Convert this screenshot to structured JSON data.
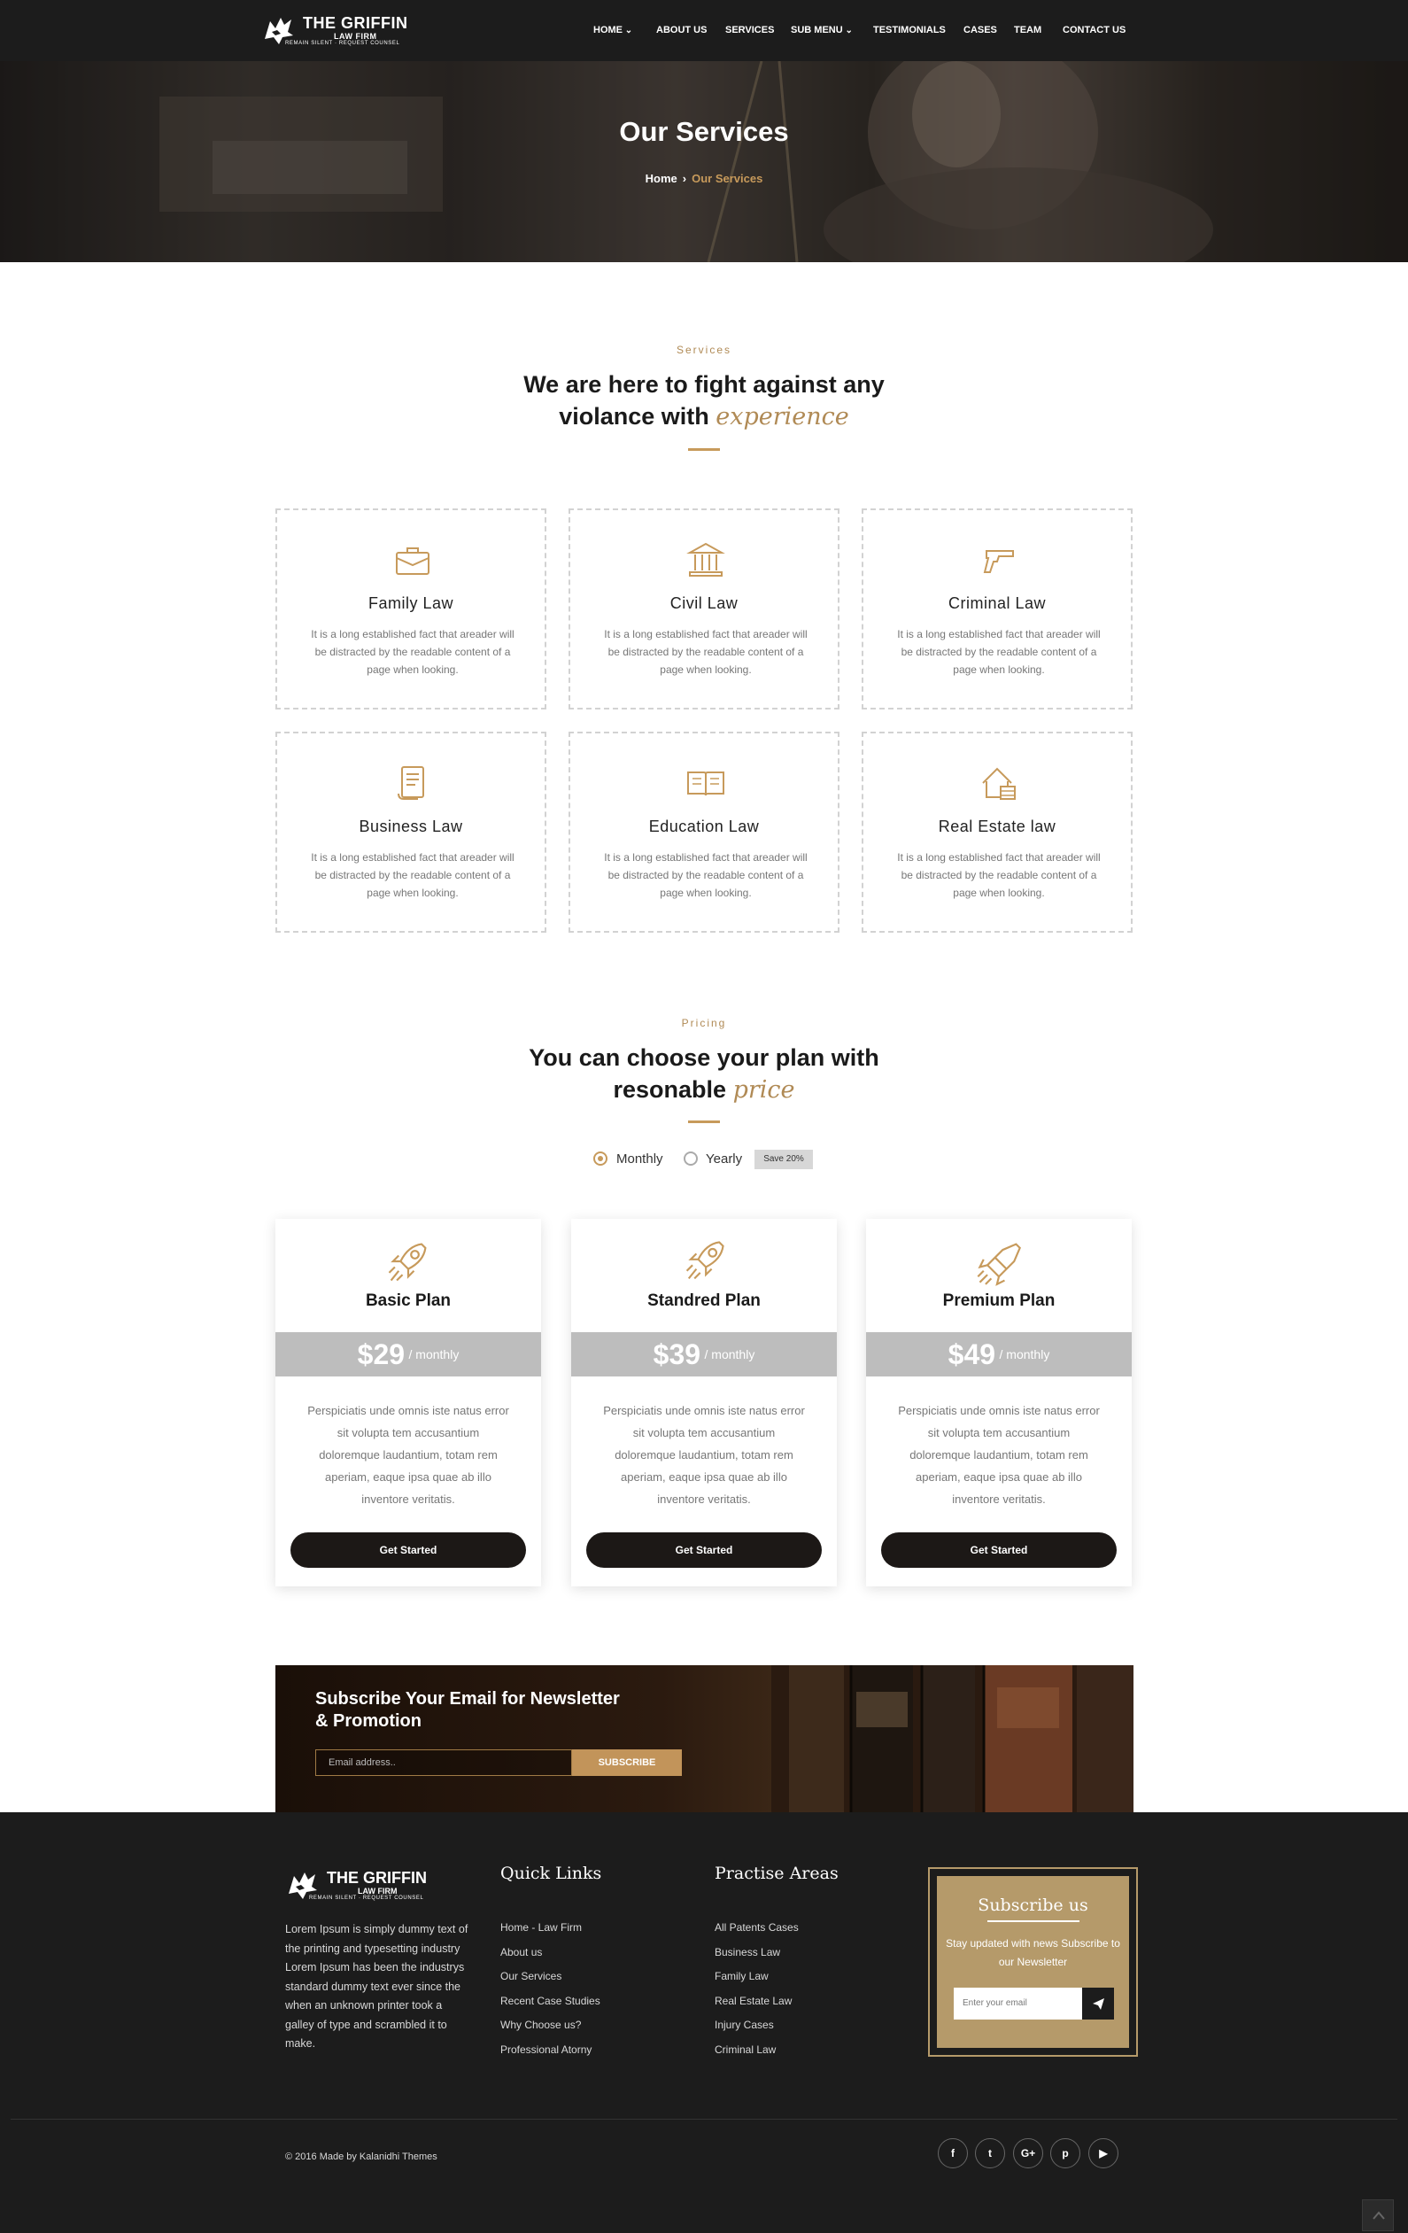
{
  "brand": {
    "name": "THE GRIFFIN",
    "sub": "LAW FIRM",
    "tagline": "REMAIN SILENT · REQUEST COUNSEL"
  },
  "nav": [
    {
      "label": "HOME",
      "dropdown": true
    },
    {
      "label": "ABOUT US",
      "dropdown": false
    },
    {
      "label": "SERVICES",
      "dropdown": false
    },
    {
      "label": "SUB MENU",
      "dropdown": true
    },
    {
      "label": "TESTIMONIALS",
      "dropdown": false
    },
    {
      "label": "CASES",
      "dropdown": false
    },
    {
      "label": "TEAM",
      "dropdown": false
    },
    {
      "label": "CONTACT US",
      "dropdown": false
    }
  ],
  "hero": {
    "title": "Our Services",
    "crumb_home": "Home",
    "crumb_sep": "›",
    "crumb_current": "Our Services"
  },
  "services": {
    "eyebrow": "Services",
    "title_line1": "We are here to fight against any",
    "title_line2": "violance with",
    "title_accent": "experience",
    "items": [
      {
        "icon": "briefcase-icon",
        "title": "Family Law",
        "text": "It is a long established fact that areader will be distracted by the readable content of a page when looking."
      },
      {
        "icon": "courthouse-icon",
        "title": "Civil Law",
        "text": "It is a long established fact that areader will be distracted by the readable content of a page when looking."
      },
      {
        "icon": "handgun-icon",
        "title": "Criminal Law",
        "text": "It is a long established fact that areader will be distracted by the readable content of a page when looking."
      },
      {
        "icon": "scroll-document-icon",
        "title": "Business Law",
        "text": "It is a long established fact that areader will be distracted by the readable content of a page when looking."
      },
      {
        "icon": "open-book-icon",
        "title": "Education Law",
        "text": "It is a long established fact that areader will be distracted by the readable content of a page when looking."
      },
      {
        "icon": "house-icon",
        "title": "Real Estate law",
        "text": "It is a long established fact that areader will be distracted by the readable content of a page when looking."
      }
    ]
  },
  "pricing": {
    "eyebrow": "Pricing",
    "title_line1": "You can choose your plan with",
    "title_line2": "resonable",
    "title_accent": "price",
    "toggle_monthly": "Monthly",
    "toggle_yearly": "Yearly",
    "save_badge": "Save 20%",
    "selected": "Monthly",
    "plans": [
      {
        "icon": "rocket-icon",
        "name": "Basic Plan",
        "price": "$29",
        "period": "/ monthly",
        "text": "Perspiciatis unde omnis iste natus error sit volupta tem accusantium doloremque laudantium, totam rem aperiam, eaque ipsa quae ab illo inventore veritatis.",
        "button": "Get Started"
      },
      {
        "icon": "rocket-launch-icon",
        "name": "Standred Plan",
        "price": "$39",
        "period": "/ monthly",
        "text": "Perspiciatis unde omnis iste natus error sit volupta tem accusantium doloremque laudantium, totam rem aperiam, eaque ipsa quae ab illo inventore veritatis.",
        "button": "Get Started"
      },
      {
        "icon": "space-shuttle-icon",
        "name": "Premium Plan",
        "price": "$49",
        "period": "/ monthly",
        "text": "Perspiciatis unde omnis iste natus error sit volupta tem accusantium doloremque laudantium, totam rem aperiam, eaque ipsa quae ab illo inventore veritatis.",
        "button": "Get Started"
      }
    ]
  },
  "newsletter": {
    "title_line1": "Subscribe Your Email for Newsletter",
    "title_line2": "& Promotion",
    "placeholder": "Email address..",
    "button": "SUBSCRIBE"
  },
  "footer": {
    "about": "Lorem Ipsum is simply dummy text of the printing and typesetting industry Lorem Ipsum has been the industrys standard dummy text ever since the when an unknown printer took a galley of type and scrambled it to make.",
    "quick_links_title": "Quick Links",
    "quick_links": [
      "Home - Law Firm",
      "About us",
      "Our Services",
      "Recent Case Studies",
      "Why Choose us?",
      "Professional Atorny"
    ],
    "practise_title": "Practise Areas",
    "practise_links": [
      "All Patents Cases",
      "Business Law",
      "Family Law",
      "Real Estate Law",
      "Injury Cases",
      "Criminal Law"
    ],
    "subscribe_title": "Subscribe us",
    "subscribe_text": "Stay updated with news Subscribe to our Newsletter",
    "subscribe_placeholder": "Enter your email",
    "copyright": "© 2016 Made by Kalanidhi Themes",
    "social": [
      {
        "icon": "facebook-icon",
        "glyph": "f"
      },
      {
        "icon": "twitter-icon",
        "glyph": "t"
      },
      {
        "icon": "google-plus-icon",
        "glyph": "G+"
      },
      {
        "icon": "pinterest-icon",
        "glyph": "p"
      },
      {
        "icon": "youtube-icon",
        "glyph": "▶"
      }
    ]
  },
  "colors": {
    "accent": "#c79a5b",
    "dark": "#1c1c1c",
    "price_band": "#bdbdbd",
    "footer_sub_box": "#b59a6a"
  }
}
